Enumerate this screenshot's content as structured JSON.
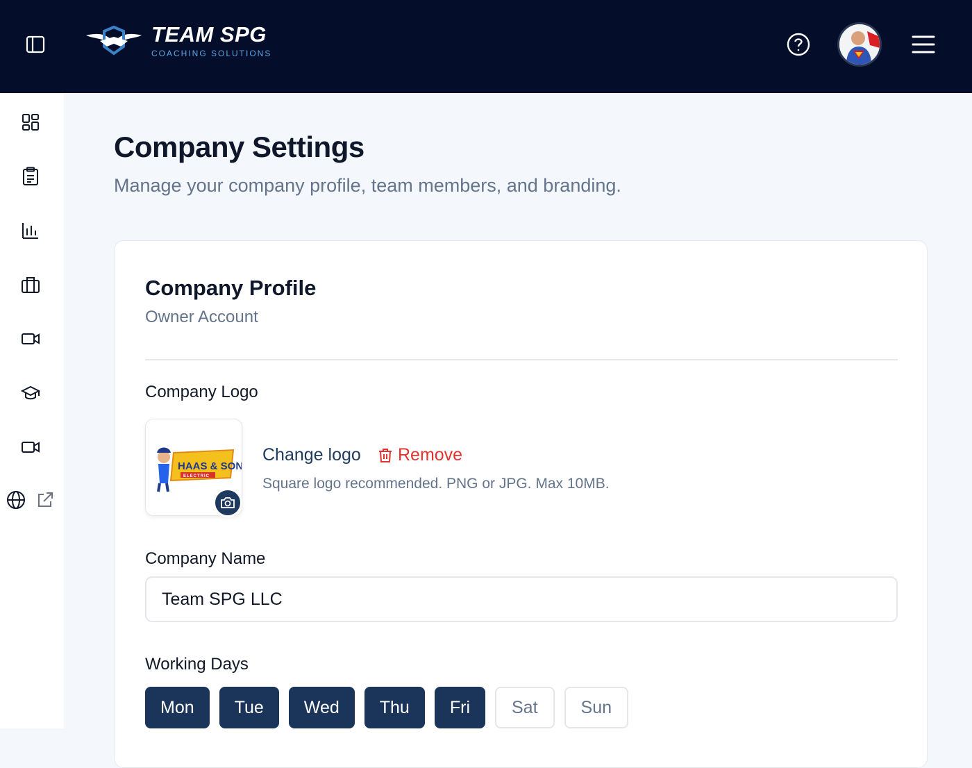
{
  "brand": {
    "name": "TEAM SPG",
    "tagline": "COACHING SOLUTIONS"
  },
  "header": {
    "help_icon": "question-circle-icon",
    "menu_icon": "hamburger-icon"
  },
  "sidebar": {
    "items": [
      {
        "icon": "dashboard-grid-icon"
      },
      {
        "icon": "clipboard-list-icon"
      },
      {
        "icon": "bar-chart-icon"
      },
      {
        "icon": "briefcase-icon"
      },
      {
        "icon": "video-camera-icon"
      },
      {
        "icon": "graduation-cap-icon"
      },
      {
        "icon": "video-camera-icon"
      },
      {
        "icon": "globe-icon"
      },
      {
        "icon": "external-link-icon"
      }
    ]
  },
  "page": {
    "title": "Company Settings",
    "subtitle": "Manage your company profile, team members, and branding."
  },
  "profile": {
    "title": "Company Profile",
    "subtitle": "Owner Account",
    "logo_label": "Company Logo",
    "logo_text_main": "HAAS & SONS",
    "logo_text_sub": "ELECTRIC",
    "change_logo": "Change logo",
    "remove": "Remove",
    "logo_hint": "Square logo recommended. PNG or JPG. Max 10MB.",
    "name_label": "Company Name",
    "name_value": "Team SPG LLC",
    "days_label": "Working Days",
    "days": [
      {
        "label": "Mon",
        "active": true
      },
      {
        "label": "Tue",
        "active": true
      },
      {
        "label": "Wed",
        "active": true
      },
      {
        "label": "Thu",
        "active": true
      },
      {
        "label": "Fri",
        "active": true
      },
      {
        "label": "Sat",
        "active": false
      },
      {
        "label": "Sun",
        "active": false
      }
    ]
  },
  "colors": {
    "header_bg": "#040e2b",
    "primary": "#1b355a",
    "danger": "#e1342f",
    "muted": "#64748b"
  }
}
